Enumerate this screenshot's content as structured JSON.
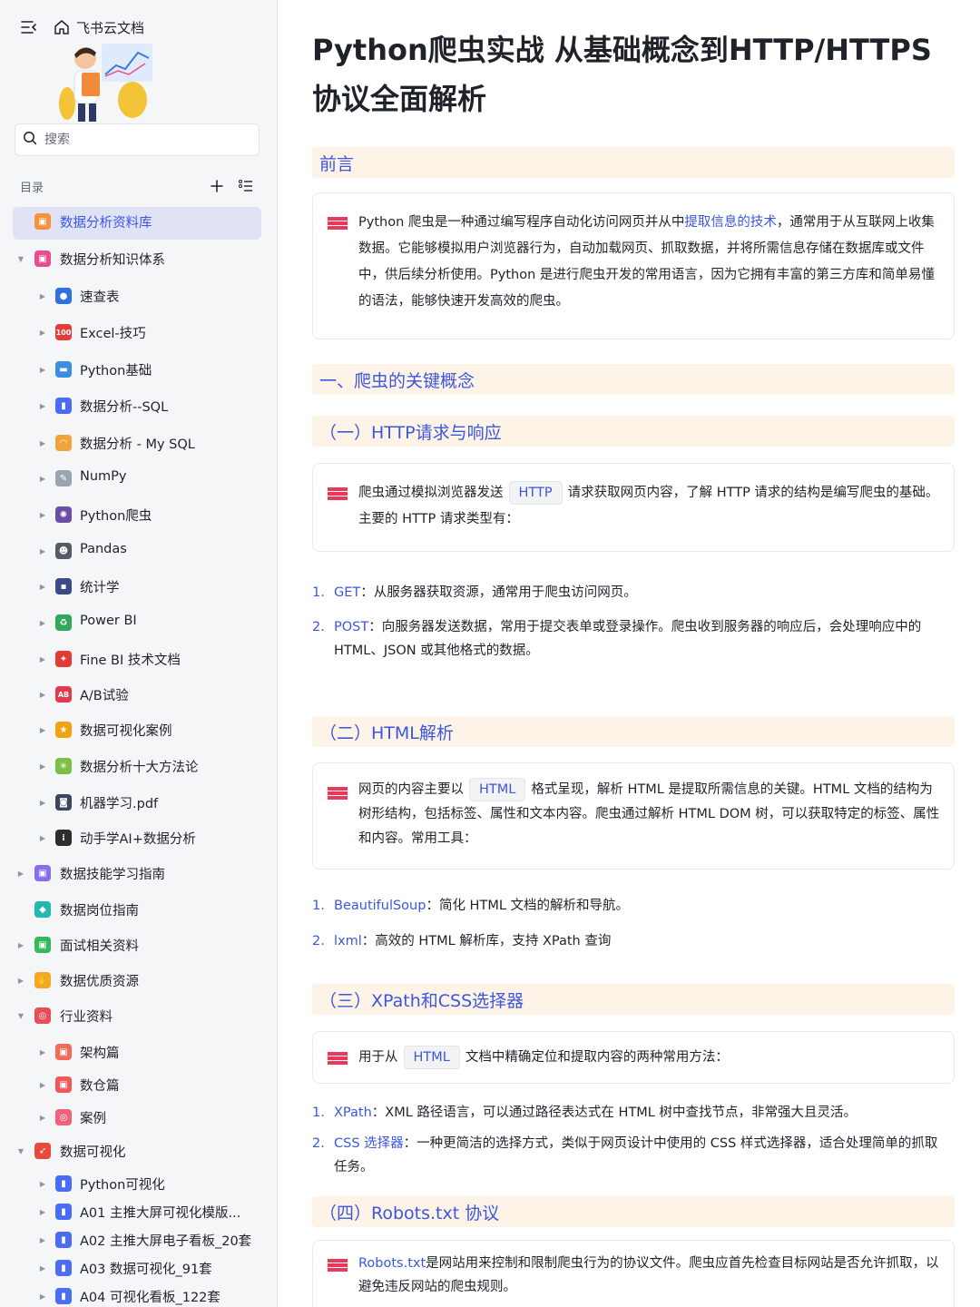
{
  "app": {
    "brand": "飞书云文档"
  },
  "search": {
    "placeholder": "搜索"
  },
  "toc": {
    "label": "目录"
  },
  "tree": [
    {
      "label": "数据分析资料库",
      "level": 0,
      "arrow": "none",
      "icon": "folder-orange-icon",
      "color": "#f7913b",
      "glyph": "▣",
      "selected": true
    },
    {
      "label": "数据分析知识体系",
      "level": 0,
      "arrow": "down",
      "icon": "folder-pink-icon",
      "color": "#e84e8f",
      "glyph": "▣"
    },
    {
      "label": "速查表",
      "level": 1,
      "arrow": "right",
      "icon": "magnifier-icon",
      "color": "#2f6fe6",
      "glyph": "●"
    },
    {
      "label": "Excel-技巧",
      "level": 1,
      "arrow": "right",
      "icon": "hundred-icon",
      "color": "#e43b3b",
      "glyph": "100"
    },
    {
      "label": "Python基础",
      "level": 1,
      "arrow": "right",
      "icon": "monitor-icon",
      "color": "#3a8ee6",
      "glyph": "▬"
    },
    {
      "label": "数据分析--SQL",
      "level": 1,
      "arrow": "right",
      "icon": "bar-chart-icon",
      "color": "#4a6cf7",
      "glyph": "▮"
    },
    {
      "label": "数据分析 - My SQL",
      "level": 1,
      "arrow": "right",
      "icon": "rainbow-icon",
      "color": "#f3a33b",
      "glyph": "◠"
    },
    {
      "label": "NumPy",
      "level": 1,
      "arrow": "right",
      "icon": "memo-icon",
      "color": "#9aa3b2",
      "glyph": "✎"
    },
    {
      "label": "Python爬虫",
      "level": 1,
      "arrow": "right",
      "icon": "spider-icon",
      "color": "#6b4ea8",
      "glyph": "✺"
    },
    {
      "label": "Pandas",
      "level": 1,
      "arrow": "right",
      "icon": "panda-icon",
      "color": "#555b66",
      "glyph": "☻"
    },
    {
      "label": "统计学",
      "level": 1,
      "arrow": "right",
      "icon": "floppy-disk-icon",
      "color": "#3d4a8a",
      "glyph": "▪"
    },
    {
      "label": "Power BI",
      "level": 1,
      "arrow": "right",
      "icon": "recycle-icon",
      "color": "#2fa85a",
      "glyph": "♻"
    },
    {
      "label": "Fine BI 技术文档",
      "level": 1,
      "arrow": "right",
      "icon": "pin-icon",
      "color": "#e53935",
      "glyph": "✦"
    },
    {
      "label": "A/B试验",
      "level": 1,
      "arrow": "right",
      "icon": "ab-icon",
      "color": "#e53950",
      "glyph": "AB"
    },
    {
      "label": "数据可视化案例",
      "level": 1,
      "arrow": "right",
      "icon": "medal-icon",
      "color": "#f2a20c",
      "glyph": "★"
    },
    {
      "label": "数据分析十大方法论",
      "level": 1,
      "arrow": "right",
      "icon": "sparkle-icon",
      "color": "#7bc043",
      "glyph": "✳"
    },
    {
      "label": "机器学习.pdf",
      "level": 1,
      "arrow": "right",
      "icon": "robot-icon",
      "color": "#3a4560",
      "glyph": "◙"
    },
    {
      "label": "动手学AI+数据分析",
      "level": 1,
      "arrow": "right",
      "icon": "traffic-light-icon",
      "color": "#2d2d2d",
      "glyph": "⁞"
    },
    {
      "label": "数据技能学习指南",
      "level": 0,
      "arrow": "right",
      "icon": "folder-violet-icon",
      "color": "#8a6cf0",
      "glyph": "▣"
    },
    {
      "label": "数据岗位指南",
      "level": 0,
      "arrow": "none",
      "icon": "folder-teal-icon",
      "color": "#22b8b0",
      "glyph": "◆"
    },
    {
      "label": "面试相关资料",
      "level": 0,
      "arrow": "right",
      "icon": "folder-green-icon",
      "color": "#34b85a",
      "glyph": "▣"
    },
    {
      "label": "数据优质资源",
      "level": 0,
      "arrow": "right",
      "icon": "thumbs-up-icon",
      "color": "#f5a623",
      "glyph": "✋"
    },
    {
      "label": "行业资料",
      "level": 0,
      "arrow": "down",
      "icon": "target-icon",
      "color": "#e84e5a",
      "glyph": "◎"
    },
    {
      "label": "架构篇",
      "level": 1,
      "arrow": "right",
      "icon": "folder-coral-icon",
      "color": "#f26b5a",
      "glyph": "▣"
    },
    {
      "label": "数仓篇",
      "level": 1,
      "arrow": "right",
      "icon": "folder-red-icon",
      "color": "#f0585a",
      "glyph": "▣"
    },
    {
      "label": "案例",
      "level": 1,
      "arrow": "right",
      "icon": "folder-rose-icon",
      "color": "#f0627a",
      "glyph": "◎"
    },
    {
      "label": "数据可视化",
      "level": 0,
      "arrow": "down",
      "icon": "rocket-icon",
      "color": "#e64a3b",
      "glyph": "➶"
    },
    {
      "label": "Python可视化",
      "level": 1,
      "arrow": "right",
      "icon": "bar-chart-icon",
      "color": "#4a6cf7",
      "glyph": "▮"
    },
    {
      "label": "A01 主推大屏可视化模版...",
      "level": 1,
      "arrow": "right",
      "icon": "bar-chart-icon",
      "color": "#4a6cf7",
      "glyph": "▮"
    },
    {
      "label": "A02 主推大屏电子看板_20套",
      "level": 1,
      "arrow": "right",
      "icon": "bar-chart-icon",
      "color": "#4a6cf7",
      "glyph": "▮"
    },
    {
      "label": "A03 数据可视化_91套",
      "level": 1,
      "arrow": "right",
      "icon": "bar-chart-icon",
      "color": "#4a6cf7",
      "glyph": "▮"
    },
    {
      "label": "A04 可视化看板_122套",
      "level": 1,
      "arrow": "right",
      "icon": "bar-chart-icon",
      "color": "#4a6cf7",
      "glyph": "▮"
    }
  ],
  "doc": {
    "title": "Python爬虫实战 从基础概念到HTTP/HTTPS协议全面解析",
    "preface": {
      "heading": "前言",
      "text_a": "Python 爬虫是一种通过编写程序自动化访问网页并从中",
      "link": "提取信息的技术",
      "text_b": "，通常用于从互联网上收集数据。它能够模拟用户浏览器行为，自动加载网页、抓取数据，并将所需信息存储在数据库或文件中，供后续分析使用。Python 是进行爬虫开发的常用语言，因为它拥有丰富的第三方库和简单易懂的语法，能够快速开发高效的爬虫。"
    },
    "section1": {
      "heading": "一、爬虫的关键概念"
    },
    "http": {
      "heading": "（一）HTTP请求与响应",
      "text_a": "爬虫通过模拟浏览器发送",
      "code": "HTTP",
      "text_b": "请求获取网页内容，了解 HTTP 请求的结构是编写爬虫的基础。主要的 HTTP 请求类型有：",
      "items": [
        {
          "num": "1.",
          "kw": "GET",
          "text": "：从服务器获取资源，通常用于爬虫访问网页。"
        },
        {
          "num": "2.",
          "kw": "POST",
          "text": "：向服务器发送数据，常用于提交表单或登录操作。爬虫收到服务器的响应后，会处理响应中的 HTML、JSON 或其他格式的数据。"
        }
      ]
    },
    "html": {
      "heading": "（二）HTML解析",
      "text_a": "网页的内容主要以",
      "code": "HTML",
      "text_b": "格式呈现，解析 HTML 是提取所需信息的关键。HTML 文档的结构为树形结构，包括标签、属性和文本内容。爬虫通过解析 HTML DOM 树，可以获取特定的标签、属性和内容。常用工具：",
      "items": [
        {
          "num": "1.",
          "kw": "BeautifulSoup",
          "text": "：简化 HTML 文档的解析和导航。"
        },
        {
          "num": "2.",
          "kw": "lxml",
          "text": "：高效的 HTML 解析库，支持 XPath 查询"
        }
      ]
    },
    "xpath": {
      "heading": "（三）XPath和CSS选择器",
      "text_a": "用于从",
      "code": "HTML",
      "text_b": "文档中精确定位和提取内容的两种常用方法：",
      "items": [
        {
          "num": "1.",
          "kw": "XPath",
          "text": "：XML 路径语言，可以通过路径表达式在 HTML 树中查找节点，非常强大且灵活。"
        },
        {
          "num": "2.",
          "kw": "CSS 选择器",
          "text": "：一种更简洁的选择方式，类似于网页设计中使用的 CSS 样式选择器，适合处理简单的抓取任务。"
        }
      ]
    },
    "robots": {
      "heading": "（四）Robots.txt 协议",
      "kw": "Robots.txt",
      "text": "是网站用来控制和限制爬虫行为的协议文件。爬虫应首先检查目标网站是否允许抓取，以避免违反网站的爬虫规则。"
    }
  },
  "colors": {
    "accent": "#3c56e0",
    "heading_bg": "#fdf3e6",
    "callout_mark": "#e8395a",
    "selected_bg": "#dfe3f5"
  }
}
